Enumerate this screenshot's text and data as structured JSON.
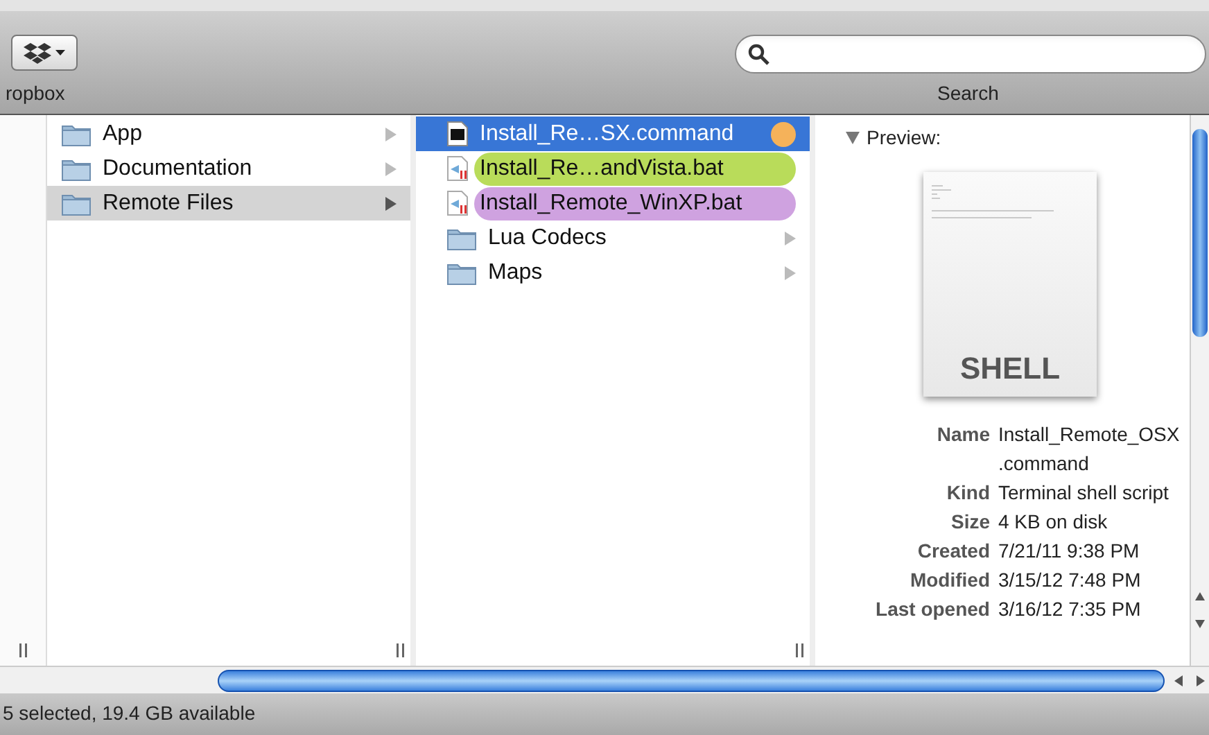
{
  "toolbar": {
    "dropbox_label": "ropbox",
    "search": {
      "label": "Search"
    }
  },
  "columns": [
    {
      "items": [
        {
          "name": "App",
          "kind": "folder",
          "selected": false
        },
        {
          "name": "Documentation",
          "kind": "folder",
          "selected": false
        },
        {
          "name": "Remote Files",
          "kind": "folder",
          "selected": true
        }
      ]
    },
    {
      "items": [
        {
          "name": "Install_Re…SX.command",
          "kind": "shell",
          "selected": true,
          "color": "#f5b25a"
        },
        {
          "name": "Install_Re…andVista.bat",
          "kind": "bat",
          "selected": false,
          "color": "#b9dc5a"
        },
        {
          "name": "Install_Remote_WinXP.bat",
          "kind": "bat",
          "selected": false,
          "color": "#cfa2e0"
        },
        {
          "name": "Lua Codecs",
          "kind": "folder",
          "selected": false
        },
        {
          "name": "Maps",
          "kind": "folder",
          "selected": false
        }
      ]
    }
  ],
  "preview": {
    "heading": "Preview:",
    "expanded": true,
    "thumbnail_label": "SHELL",
    "info": [
      {
        "label": "Name",
        "value": "Install_Remote_OSX .command"
      },
      {
        "label": "Kind",
        "value": "Terminal shell script"
      },
      {
        "label": "Size",
        "value": "4 KB on disk"
      },
      {
        "label": "Created",
        "value": "7/21/11 9:38 PM"
      },
      {
        "label": "Modified",
        "value": "3/15/12 7:48 PM"
      },
      {
        "label": "Last opened",
        "value": "3/16/12 7:35 PM"
      }
    ]
  },
  "status_bar": "5 selected, 19.4 GB available"
}
